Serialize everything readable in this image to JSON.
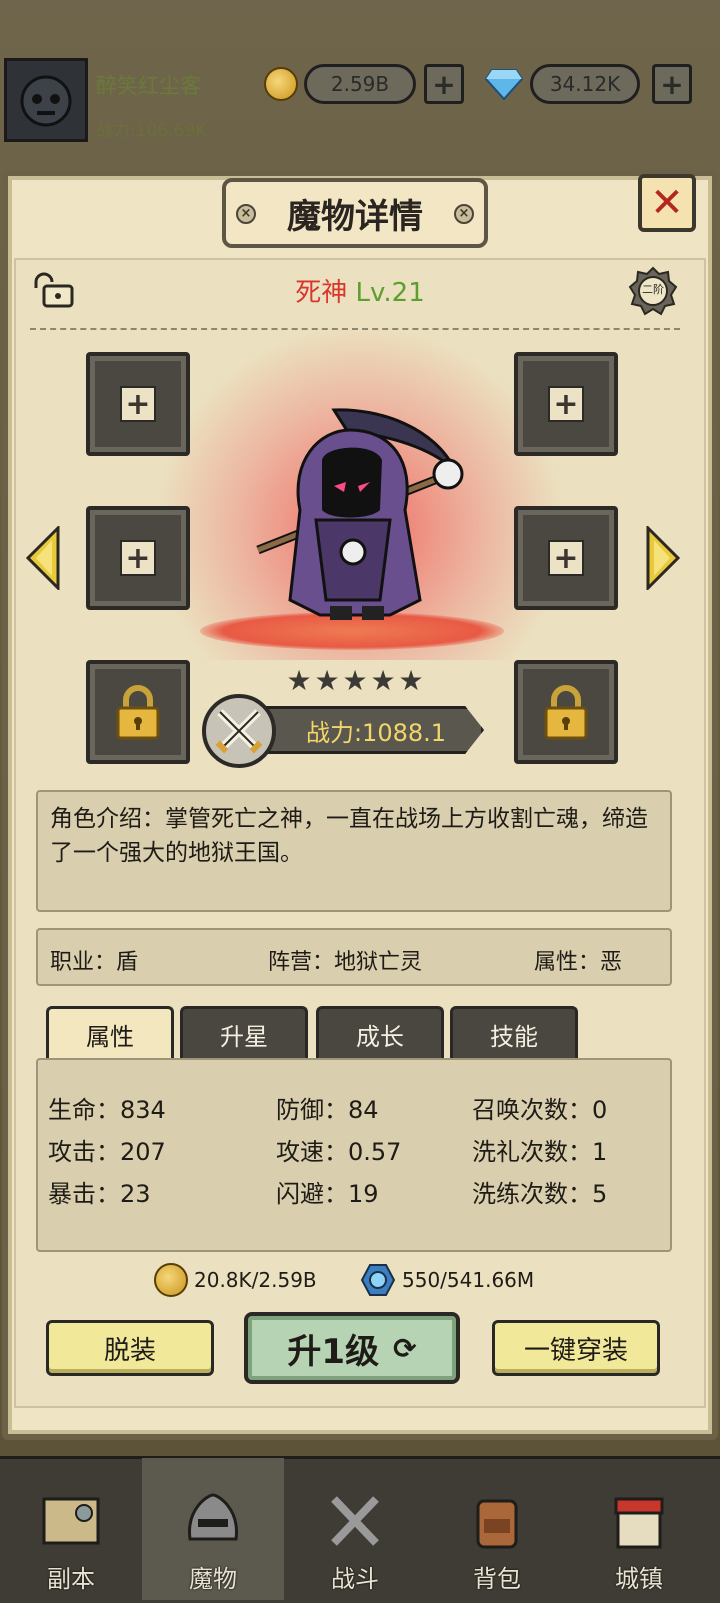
{
  "top": {
    "player_name": "醉笑红尘客",
    "power": "战力:106.69K",
    "gold": "2.59B",
    "gems": "34.12K",
    "plus": "+"
  },
  "panel": {
    "title": "魔物详情",
    "close": "✕",
    "monster_name": "死神",
    "monster_level": "Lv.21",
    "rank_badge": "二阶",
    "star_count": 5,
    "power": "战力:1088.1",
    "description": "角色介绍：掌管死亡之神，一直在战场上方收割亡魂，缔造了一个强大的地狱王国。",
    "info": {
      "job": "职业：盾",
      "camp": "阵营：地狱亡灵",
      "attr": "属性：恶"
    },
    "tabs": [
      "属性",
      "升星",
      "成长",
      "技能"
    ],
    "stats": {
      "hp": "生命：834",
      "atk": "攻击：207",
      "crit": "暴击：23",
      "def": "防御：84",
      "spd": "攻速：0.57",
      "dodge": "闪避：19",
      "summon": "召唤次数：0",
      "baptism": "洗礼次数：1",
      "refine": "洗练次数：5"
    },
    "cost_gold": "20.8K/2.59B",
    "cost_essence": "550/541.66M",
    "btn_unequip": "脱装",
    "btn_levelup": "升1级",
    "btn_equip_all": "一键穿装"
  },
  "nav": [
    "副本",
    "魔物",
    "战斗",
    "背包",
    "城镇"
  ],
  "colors": {
    "accent_red": "#d8382c",
    "level_green": "#5e9e2e",
    "power_gold": "#f2d66a"
  }
}
